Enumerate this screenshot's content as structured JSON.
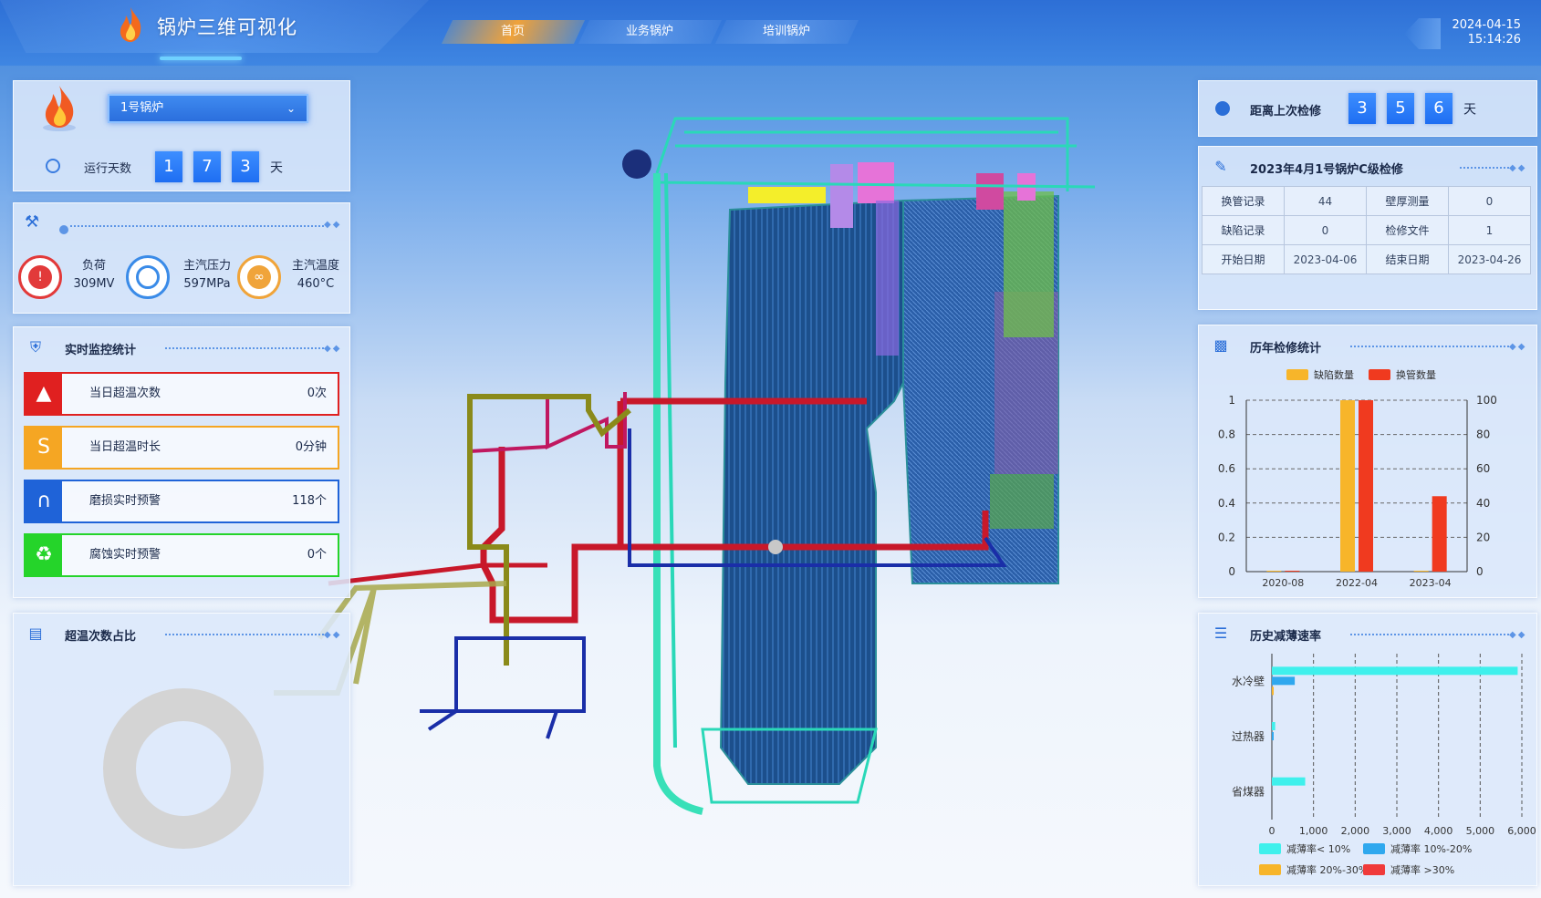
{
  "header": {
    "app_title": "锅炉三维可视化",
    "nav": [
      "首页",
      "业务锅炉",
      "培训锅炉"
    ],
    "active_nav": 0,
    "date": "2024-04-15",
    "time": "15:14:26"
  },
  "boiler_selector": {
    "selected": "1号锅炉"
  },
  "running_days": {
    "label": "运行天数",
    "digits": [
      "1",
      "7",
      "3"
    ],
    "unit": "天"
  },
  "gauges": [
    {
      "label": "负荷",
      "value": "309MV",
      "color": "#e23a3a",
      "icon": "fire-alarm-icon"
    },
    {
      "label": "主汽压力",
      "value": "597MPa",
      "color": "#3a8be8",
      "icon": "pressure-gauge-icon"
    },
    {
      "label": "主汽温度",
      "value": "460°C",
      "color": "#f0a43a",
      "icon": "thermometer-icon"
    }
  ],
  "realtime": {
    "title": "实时监控统计",
    "items": [
      {
        "label": "当日超温次数",
        "value": "0次",
        "color": "#e02020",
        "icon": "siren-icon"
      },
      {
        "label": "当日超温时长",
        "value": "0分钟",
        "color": "#f5a623",
        "icon": "duration-icon"
      },
      {
        "label": "磨损实时预警",
        "value": "118个",
        "color": "#1f63d8",
        "icon": "wear-icon"
      },
      {
        "label": "腐蚀实时预警",
        "value": "0个",
        "color": "#25d42a",
        "icon": "corrosion-icon"
      }
    ]
  },
  "overtemp_ratio": {
    "title": "超温次数占比"
  },
  "last_maintenance": {
    "label": "距离上次检修",
    "digits": [
      "3",
      "5",
      "6"
    ],
    "unit": "天"
  },
  "maintenance_record": {
    "title": "2023年4月1号锅炉C级检修",
    "rows": [
      [
        "换管记录",
        "44",
        "壁厚测量",
        "0"
      ],
      [
        "缺陷记录",
        "0",
        "检修文件",
        "1"
      ],
      [
        "开始日期",
        "2023-04-06",
        "结束日期",
        "2023-04-26"
      ]
    ]
  },
  "yearly_stats": {
    "title": "历年检修统计",
    "chart_data": {
      "type": "bar",
      "categories": [
        "2020-08",
        "2022-04",
        "2023-04"
      ],
      "series": [
        {
          "name": "缺陷数量",
          "values": [
            0,
            1,
            0
          ],
          "axis": "left",
          "color": "#f7b52a"
        },
        {
          "name": "换管数量",
          "values": [
            0,
            100,
            44
          ],
          "axis": "right",
          "color": "#f03a1f"
        }
      ],
      "y_left_ticks": [
        "0",
        "0.2",
        "0.4",
        "0.6",
        "0.8",
        "1"
      ],
      "y_right_ticks": [
        "0",
        "20",
        "40",
        "60",
        "80",
        "100"
      ],
      "ylim_left": [
        0,
        1
      ],
      "ylim_right": [
        0,
        100
      ],
      "legend": "top"
    }
  },
  "thinning_rate": {
    "title": "历史减薄速率",
    "chart_data": {
      "type": "bar",
      "orientation": "horizontal",
      "categories": [
        "水冷壁",
        "过热器",
        "省煤器"
      ],
      "series": [
        {
          "name": "减薄率< 10%",
          "values": [
            5900,
            80,
            800
          ],
          "color": "#3ff0ec"
        },
        {
          "name": "减薄率 10%-20%",
          "values": [
            550,
            20,
            0
          ],
          "color": "#2fa8ee"
        },
        {
          "name": "减薄率 20%-30%",
          "values": [
            30,
            0,
            0
          ],
          "color": "#f7b52a"
        },
        {
          "name": "减薄率 >30%",
          "values": [
            0,
            0,
            0
          ],
          "color": "#f03a3a"
        }
      ],
      "x_ticks": [
        "0",
        "1,000",
        "2,000",
        "3,000",
        "4,000",
        "5,000",
        "6,000"
      ],
      "xlim": [
        0,
        6000
      ],
      "legend": "bottom"
    }
  }
}
